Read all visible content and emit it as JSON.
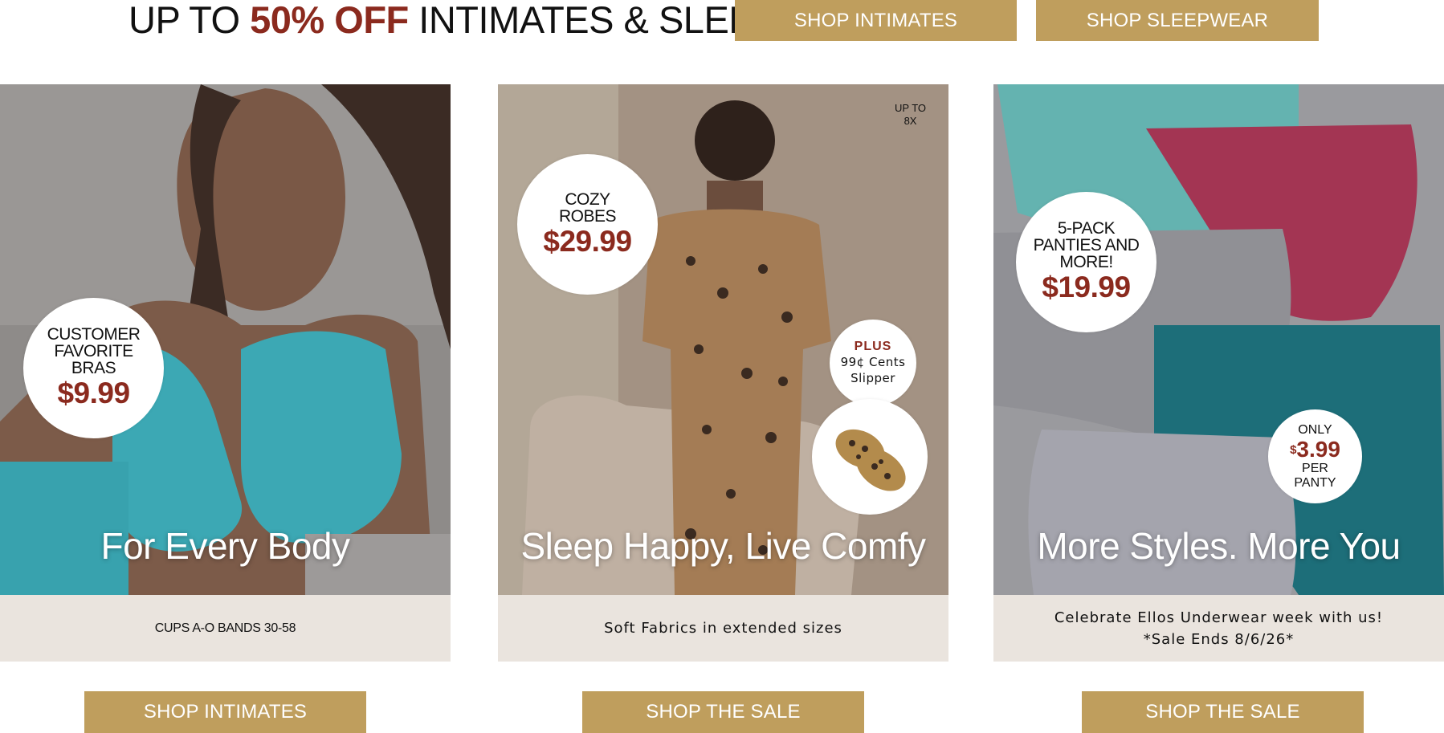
{
  "header": {
    "headline_pre": "UP TO ",
    "headline_accent": "50% OFF",
    "headline_post": " INTIMATES & SLEEP",
    "shop_intimates": "SHOP INTIMATES",
    "shop_sleepwear": "SHOP SLEEPWEAR"
  },
  "cards": [
    {
      "overlay_title": "For Every Body",
      "badge_lines": [
        "CUSTOMER",
        "FAVORITE",
        "BRAS"
      ],
      "badge_price": "$9.99",
      "caption_lines": [
        "CUPS A-O BANDS 30-58"
      ],
      "button": "SHOP INTIMATES"
    },
    {
      "overlay_title": "Sleep Happy, Live Comfy",
      "badge_lines": [
        "COZY",
        "ROBES"
      ],
      "badge_price": "$29.99",
      "upto_lines": [
        "UP TO",
        "8X"
      ],
      "plus_badge": {
        "plus": "PLUS",
        "line1": "99¢ Cents",
        "line2": "Slipper"
      },
      "caption_lines": [
        "Soft Fabrics in extended sizes"
      ],
      "button": "SHOP THE SALE"
    },
    {
      "overlay_title": "More Styles. More You",
      "badge_lines": [
        "5-PACK",
        "PANTIES AND",
        "MORE!"
      ],
      "badge_price": "$19.99",
      "only_badge": {
        "only": "ONLY",
        "currency": "$",
        "amount": "3.99",
        "per": "PER",
        "unit": "PANTY"
      },
      "caption_lines": [
        "Celebrate Ellos Underwear week with us!",
        "*Sale Ends 8/6/26*"
      ],
      "button": "SHOP THE SALE"
    }
  ],
  "colors": {
    "gold": "#bf9e5d",
    "accent_red": "#8b2a1e",
    "caption_bg": "#eae4de"
  }
}
